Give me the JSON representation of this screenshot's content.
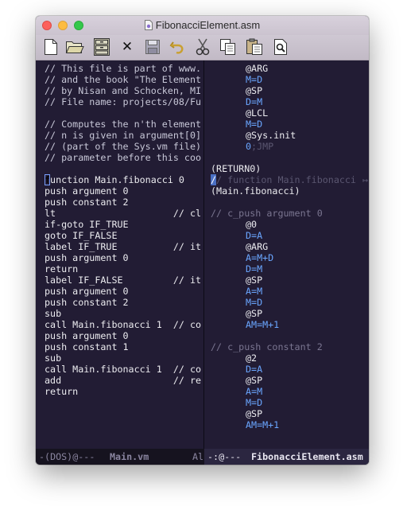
{
  "window": {
    "title": "FibonacciElement.asm"
  },
  "toolbar": {
    "items": [
      "new-file-icon",
      "open-folder-icon",
      "save-cabinet-icon",
      "close-icon",
      "save-disk-icon",
      "undo-icon",
      "cut-icon",
      "copy-icon",
      "paste-icon",
      "find-icon"
    ],
    "close_glyph": "✕"
  },
  "left_pane": {
    "lines": [
      "// This file is part of www.",
      "// and the book \"The Element",
      "// by Nisan and Schocken, MI",
      "// File name: projects/08/Fu",
      "",
      "// Computes the n'th element",
      "// n is given in argument[0]",
      "// (part of the Sys.vm file)",
      "// parameter before this coo",
      "",
      "function Main.fibonacci 0",
      "push argument 0",
      "push constant 2",
      "lt                     // cl",
      "if-goto IF_TRUE",
      "goto IF_FALSE",
      "label IF_TRUE          // it",
      "push argument 0",
      "return",
      "label IF_FALSE         // it",
      "push argument 0",
      "push constant 2",
      "sub",
      "call Main.fibonacci 1  // co",
      "push argument 0",
      "push constant 1",
      "sub",
      "call Main.fibonacci 1  // co",
      "add                    // re",
      "return"
    ],
    "cursor_char": "f",
    "cursor_line_rest": "unction Main.fibonacci 0"
  },
  "right_pane": {
    "lines": [
      {
        "text": "@ARG",
        "style": "code",
        "indent": 1
      },
      {
        "text": "M=D",
        "style": "blue",
        "indent": 1
      },
      {
        "text": "@SP",
        "style": "code",
        "indent": 1
      },
      {
        "text": "D=M",
        "style": "blue",
        "indent": 1
      },
      {
        "text": "@LCL",
        "style": "code",
        "indent": 1
      },
      {
        "text": "M=D",
        "style": "blue",
        "indent": 1
      },
      {
        "text": "@Sys.init",
        "style": "code",
        "indent": 1
      },
      {
        "text": "0;JMP",
        "style": "split",
        "indent": 1
      },
      {
        "text": "",
        "style": "code",
        "indent": 0
      },
      {
        "text": "(RETURN0)",
        "style": "code",
        "indent": 0
      },
      {
        "text": "/ function Main.fibonacci",
        "style": "cursorcomment",
        "indent": 0
      },
      {
        "text": "(Main.fibonacci)",
        "style": "code",
        "indent": 0
      },
      {
        "text": "",
        "style": "code",
        "indent": 0
      },
      {
        "text": "// c_push argument 0",
        "style": "dim",
        "indent": 0
      },
      {
        "text": "@0",
        "style": "code",
        "indent": 1
      },
      {
        "text": "D=A",
        "style": "blue",
        "indent": 1
      },
      {
        "text": "@ARG",
        "style": "code",
        "indent": 1
      },
      {
        "text": "A=M+D",
        "style": "blue",
        "indent": 1
      },
      {
        "text": "D=M",
        "style": "blue",
        "indent": 1
      },
      {
        "text": "@SP",
        "style": "code",
        "indent": 1
      },
      {
        "text": "A=M",
        "style": "blue",
        "indent": 1
      },
      {
        "text": "M=D",
        "style": "blue",
        "indent": 1
      },
      {
        "text": "@SP",
        "style": "code",
        "indent": 1
      },
      {
        "text": "AM=M+1",
        "style": "blue",
        "indent": 1
      },
      {
        "text": "",
        "style": "code",
        "indent": 0
      },
      {
        "text": "// c_push constant 2",
        "style": "dim",
        "indent": 0
      },
      {
        "text": "@2",
        "style": "code",
        "indent": 1
      },
      {
        "text": "D=A",
        "style": "blue",
        "indent": 1
      },
      {
        "text": "@SP",
        "style": "code",
        "indent": 1
      },
      {
        "text": "A=M",
        "style": "blue",
        "indent": 1
      },
      {
        "text": "M=D",
        "style": "blue",
        "indent": 1
      },
      {
        "text": "@SP",
        "style": "code",
        "indent": 1
      },
      {
        "text": "AM=M+1",
        "style": "blue",
        "indent": 1
      }
    ],
    "split_prefix": "0",
    "split_suffix": ";JMP",
    "cursor_char": "/",
    "overflow_marker": "↦"
  },
  "modeline": {
    "left_status": "-(DOS)@---",
    "left_buffer": "Main.vm",
    "left_tail": "Al",
    "right_status": "-:@---",
    "right_buffer": "FibonacciElement.asm"
  },
  "colors": {
    "background": "#221c34",
    "keyword_blue": "#6aa6ff",
    "comment_dim": "#7a7590"
  }
}
